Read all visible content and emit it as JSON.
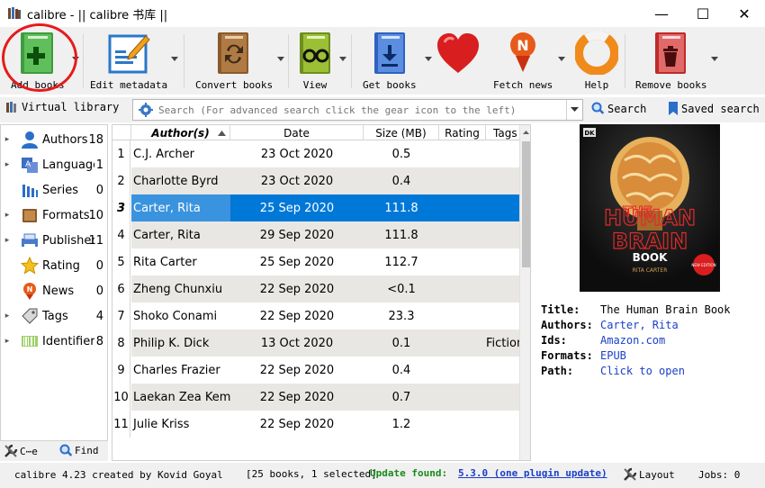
{
  "window": {
    "title": "calibre - || calibre 书库 ||",
    "minimize_glyph": "—",
    "maximize_glyph": "☐",
    "close_glyph": "✕"
  },
  "toolbar": {
    "add_books": "Add books",
    "edit_metadata": "Edit metadata",
    "convert_books": "Convert books",
    "view": "View",
    "get_books": "Get books",
    "fetch_news": "Fetch news",
    "help": "Help",
    "remove_books": "Remove books"
  },
  "searchbar": {
    "virtual_library": "Virtual library",
    "placeholder": "Search (For advanced search click the gear icon to the left)",
    "search_button": "Search",
    "saved_search": "Saved search"
  },
  "tag_browser": {
    "items": [
      {
        "name": "Authors",
        "count": "18",
        "icon": "person-icon"
      },
      {
        "name": "Language",
        "count": "1",
        "icon": "language-icon"
      },
      {
        "name": "Series",
        "count": "0",
        "icon": "series-icon"
      },
      {
        "name": "Formats",
        "count": "10",
        "icon": "book-icon"
      },
      {
        "name": "Publisher",
        "count": "11",
        "icon": "publisher-icon"
      },
      {
        "name": "Rating",
        "count": "0",
        "icon": "star-icon"
      },
      {
        "name": "News",
        "count": "0",
        "icon": "news-icon"
      },
      {
        "name": "Tags",
        "count": "4",
        "icon": "tag-icon"
      },
      {
        "name": "Identifier",
        "count": "8",
        "icon": "barcode-icon"
      }
    ],
    "configure": "C⋯e",
    "find": "Find"
  },
  "books_table": {
    "columns": [
      "Author(s)",
      "Date",
      "Size (MB)",
      "Rating",
      "Tags"
    ],
    "rows": [
      {
        "n": "1",
        "author": "C.J. Archer",
        "date": "23 Oct 2020",
        "size": "0.5",
        "tags": ""
      },
      {
        "n": "2",
        "author": "Charlotte Byrd",
        "date": "23 Oct 2020",
        "size": "0.4",
        "tags": ""
      },
      {
        "n": "3",
        "author": "Carter, Rita",
        "date": "25 Sep 2020",
        "size": "111.8",
        "tags": ""
      },
      {
        "n": "4",
        "author": "Carter, Rita",
        "date": "29 Sep 2020",
        "size": "111.8",
        "tags": ""
      },
      {
        "n": "5",
        "author": "Rita Carter",
        "date": "25 Sep 2020",
        "size": "112.7",
        "tags": ""
      },
      {
        "n": "6",
        "author": "Zheng Chunxiu",
        "date": "22 Sep 2020",
        "size": "<0.1",
        "tags": ""
      },
      {
        "n": "7",
        "author": "Shoko Conami",
        "date": "22 Sep 2020",
        "size": "23.3",
        "tags": ""
      },
      {
        "n": "8",
        "author": "Philip K. Dick",
        "date": "13 Oct 2020",
        "size": "0.1",
        "tags": "Fiction"
      },
      {
        "n": "9",
        "author": "Charles Frazier",
        "date": "22 Sep 2020",
        "size": "0.4",
        "tags": ""
      },
      {
        "n": "10",
        "author": "Laekan Zea Kemp",
        "date": "22 Sep 2020",
        "size": "0.7",
        "tags": ""
      },
      {
        "n": "11",
        "author": "Julie Kriss",
        "date": "22 Sep 2020",
        "size": "1.2",
        "tags": ""
      }
    ]
  },
  "cover": {
    "line1": "THE",
    "line2": "HUMAN",
    "line3": "BRAIN",
    "line4": "BOOK",
    "author": "RITA CARTER",
    "badge": "NEW EDITION",
    "publisher_mark": "DK"
  },
  "details": {
    "title_label": "Title:",
    "title": "The Human Brain Book",
    "authors_label": "Authors:",
    "authors": "Carter, Rita",
    "ids_label": "Ids:",
    "ids": "Amazon.com",
    "formats_label": "Formats:",
    "formats": "EPUB",
    "path_label": "Path:",
    "path": "Click to open"
  },
  "statusbar": {
    "credits": "calibre 4.23 created by Kovid Goyal",
    "selection": "[25 books, 1 selected]",
    "update_label": "Update found:",
    "update_link": "5.3.0 (one plugin update)",
    "layout": "Layout",
    "jobs": "Jobs: 0"
  },
  "colors": {
    "selection": "#0078d7",
    "highlight_circle": "#e51b1b",
    "update_green": "#1a8a1a",
    "link_blue": "#1a3fc9"
  }
}
